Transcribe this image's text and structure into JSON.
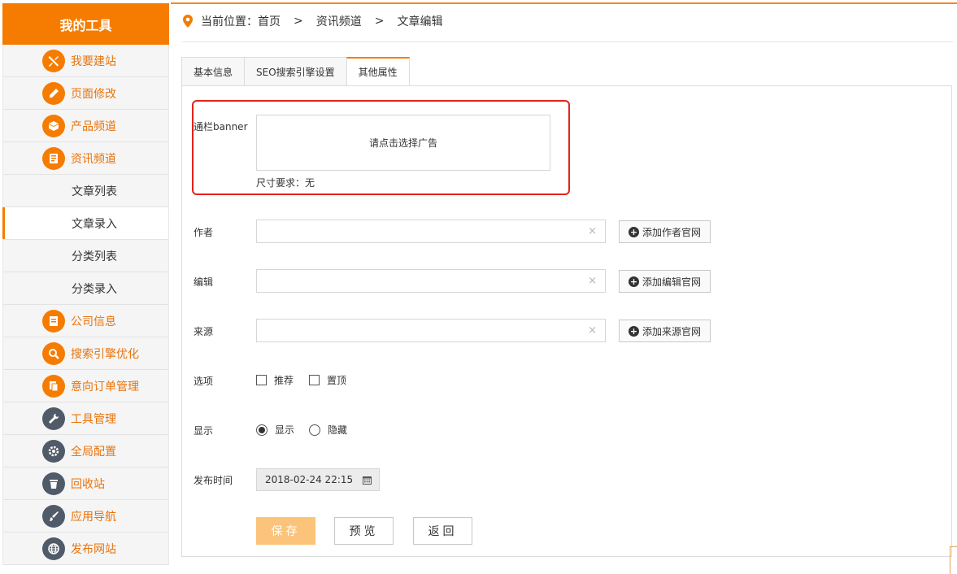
{
  "sidebar": {
    "title": "我的工具",
    "items": [
      {
        "label": "我要建站",
        "icon": "tools-icon",
        "type": "main"
      },
      {
        "label": "页面修改",
        "icon": "pencil-icon",
        "type": "main"
      },
      {
        "label": "产品频道",
        "icon": "box-icon",
        "type": "main"
      },
      {
        "label": "资讯频道",
        "icon": "newspaper-icon",
        "type": "main"
      },
      {
        "label": "文章列表",
        "type": "sub"
      },
      {
        "label": "文章录入",
        "type": "sub",
        "active": true
      },
      {
        "label": "分类列表",
        "type": "sub"
      },
      {
        "label": "分类录入",
        "type": "sub"
      },
      {
        "label": "公司信息",
        "icon": "document-icon",
        "type": "main"
      },
      {
        "label": "搜索引擎优化",
        "icon": "magnifier-icon",
        "type": "main"
      },
      {
        "label": "意向订单管理",
        "icon": "copy-icon",
        "type": "main"
      },
      {
        "label": "工具管理",
        "icon": "wrench-icon",
        "type": "main",
        "dark": true
      },
      {
        "label": "全局配置",
        "icon": "gear-icon",
        "type": "main",
        "dark": true
      },
      {
        "label": "回收站",
        "icon": "trash-icon",
        "type": "main",
        "dark": true
      },
      {
        "label": "应用导航",
        "icon": "brush-icon",
        "type": "main",
        "dark": true
      },
      {
        "label": "发布网站",
        "icon": "globe-icon",
        "type": "main",
        "dark": true
      }
    ]
  },
  "breadcrumb": {
    "prefix": "当前位置：",
    "items": [
      "首页",
      "资讯频道",
      "文章编辑"
    ],
    "separator": ">"
  },
  "tabs": [
    {
      "label": "基本信息",
      "active": false
    },
    {
      "label": "SEO搜索引擎设置",
      "active": false
    },
    {
      "label": "其他属性",
      "active": true
    }
  ],
  "form": {
    "banner": {
      "label": "通栏banner",
      "placeholder": "请点击选择广告",
      "size_note": "尺寸要求：无"
    },
    "author": {
      "label": "作者",
      "value": "",
      "clear": "×",
      "button": "添加作者官网"
    },
    "editor": {
      "label": "编辑",
      "value": "",
      "clear": "×",
      "button": "添加编辑官网"
    },
    "source": {
      "label": "来源",
      "value": "",
      "clear": "×",
      "button": "添加来源官网"
    },
    "options": {
      "label": "选项",
      "recommend": "推荐",
      "top": "置顶",
      "recommend_checked": false,
      "top_checked": false
    },
    "display": {
      "label": "显示",
      "show": "显示",
      "hide": "隐藏",
      "selected": "显示"
    },
    "publish_time": {
      "label": "发布时间",
      "value": "2018-02-24 22:15"
    }
  },
  "buttons": {
    "save": "保存",
    "preview": "预览",
    "back": "返回"
  },
  "colors": {
    "accent": "#f57c00",
    "highlight": "#e2231a",
    "save_button": "#fbc47a",
    "dark_icon": "#505a68"
  }
}
